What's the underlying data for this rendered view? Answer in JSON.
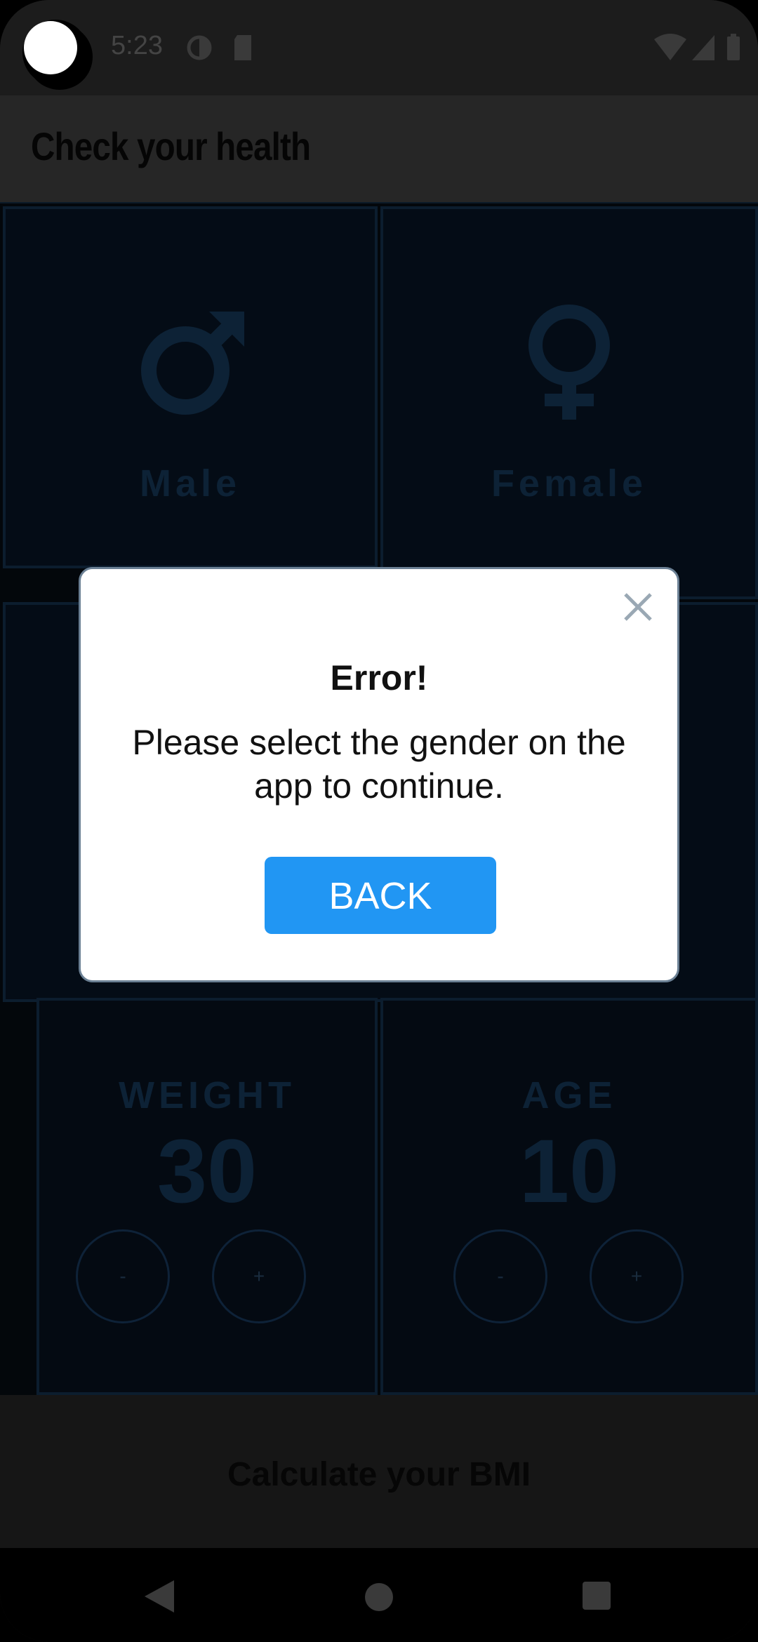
{
  "status_bar": {
    "time": "5:23"
  },
  "app_bar": {
    "title": "Check your health"
  },
  "gender": {
    "male_label": "Male",
    "female_label": "Female"
  },
  "weight": {
    "label": "WEIGHT",
    "value": "30",
    "minus": "-",
    "plus": "+"
  },
  "age": {
    "label": "AGE",
    "value": "10",
    "minus": "-",
    "plus": "+"
  },
  "calculate": {
    "label": "Calculate your BMI"
  },
  "dialog": {
    "title": "Error!",
    "message": "Please select the gender on the app to continue.",
    "back_label": "BACK"
  },
  "colors": {
    "accent": "#2196f3",
    "dim_text": "#0d2236"
  }
}
